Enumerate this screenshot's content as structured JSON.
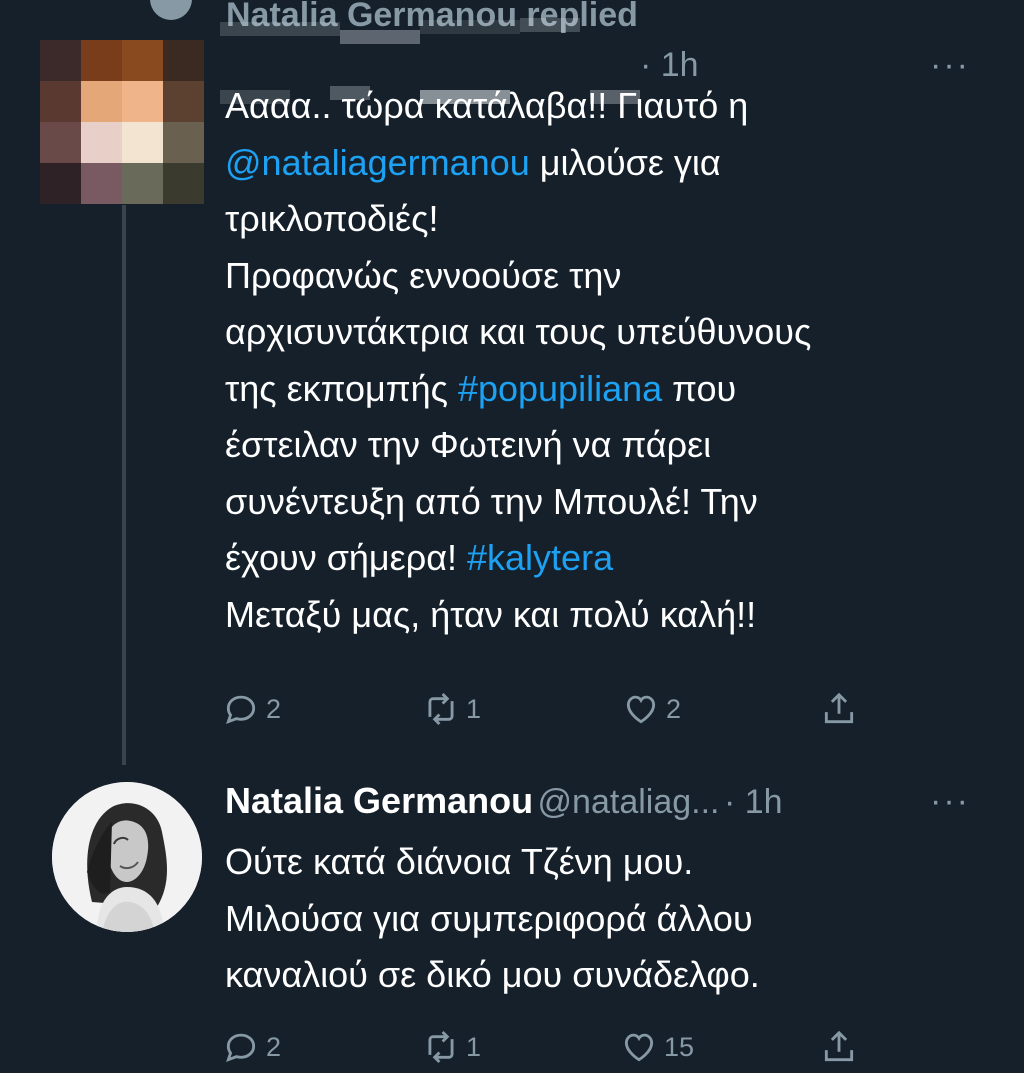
{
  "context": {
    "label": "Natalia Germanou replied"
  },
  "tweet1": {
    "time": "· 1h",
    "more": "···",
    "lines": [
      [
        "Αααα.. τώρα κατάλαβα!! Γιαυτό η"
      ],
      [
        "@nataliagermanou",
        " μιλούσε για"
      ],
      [
        "τρικλοποδιές!"
      ],
      [
        "Προφανώς εννοούσε την"
      ],
      [
        "αρχισυντάκτρια και τους υπεύθυνους"
      ],
      [
        "της εκπομπής ",
        "#popupiliana",
        " που"
      ],
      [
        "έστειλαν την Φωτεινή να πάρει"
      ],
      [
        "συνέντευξη από την Μπουλέ! Την"
      ],
      [
        "έχουν σήμερα! ",
        "#kalytera"
      ],
      [
        "Μεταξύ μας, ήταν και πολύ καλή!!"
      ]
    ],
    "line1": "Αααα.. τώρα κατάλαβα!! Γιαυτό η",
    "mention": "@nataliagermanou",
    "line2_rest": " μιλούσε για",
    "line3": "τρικλοποδιές!",
    "line4": "Προφανώς εννοούσε την",
    "line5": "αρχισυντάκτρια και τους υπεύθυνους",
    "line6_start": "της εκπομπής ",
    "hashtag1": "#popupiliana",
    "line6_end": " που",
    "line7": "έστειλαν την Φωτεινή να πάρει",
    "line8": "συνέντευξη από την Μπουλέ! Την",
    "line9_start": "έχουν σήμερα! ",
    "hashtag2": "#kalytera",
    "line10": "Μεταξύ μας, ήταν και πολύ καλή!!",
    "replies": "2",
    "retweets": "1",
    "likes": "2"
  },
  "tweet2": {
    "name": "Natalia Germanou",
    "handle": "@nataliag...",
    "time": "· 1h",
    "more": "···",
    "line1": "Ούτε κατά διάνοια Τζένη μου.",
    "line2": "Μιλούσα για συμπεριφορά άλλου",
    "line3": "καναλιού σε δικό μου συνάδελφο.",
    "replies": "2",
    "retweets": "1",
    "likes": "15"
  },
  "colors": {
    "background": "#15202b",
    "text": "#ffffff",
    "secondary": "#8899a6",
    "link": "#1da1f2",
    "thread_line": "#38444d"
  },
  "icons": [
    "reply-icon",
    "retweet-icon",
    "like-icon",
    "share-icon",
    "more-icon"
  ]
}
